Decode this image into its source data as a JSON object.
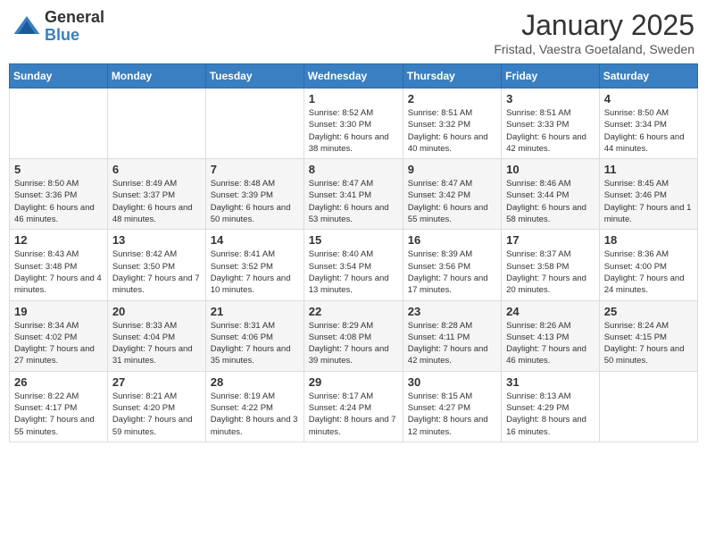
{
  "logo": {
    "general": "General",
    "blue": "Blue"
  },
  "header": {
    "month": "January 2025",
    "location": "Fristad, Vaestra Goetaland, Sweden"
  },
  "weekdays": [
    "Sunday",
    "Monday",
    "Tuesday",
    "Wednesday",
    "Thursday",
    "Friday",
    "Saturday"
  ],
  "weeks": [
    [
      {
        "day": "",
        "info": ""
      },
      {
        "day": "",
        "info": ""
      },
      {
        "day": "",
        "info": ""
      },
      {
        "day": "1",
        "info": "Sunrise: 8:52 AM\nSunset: 3:30 PM\nDaylight: 6 hours and 38 minutes."
      },
      {
        "day": "2",
        "info": "Sunrise: 8:51 AM\nSunset: 3:32 PM\nDaylight: 6 hours and 40 minutes."
      },
      {
        "day": "3",
        "info": "Sunrise: 8:51 AM\nSunset: 3:33 PM\nDaylight: 6 hours and 42 minutes."
      },
      {
        "day": "4",
        "info": "Sunrise: 8:50 AM\nSunset: 3:34 PM\nDaylight: 6 hours and 44 minutes."
      }
    ],
    [
      {
        "day": "5",
        "info": "Sunrise: 8:50 AM\nSunset: 3:36 PM\nDaylight: 6 hours and 46 minutes."
      },
      {
        "day": "6",
        "info": "Sunrise: 8:49 AM\nSunset: 3:37 PM\nDaylight: 6 hours and 48 minutes."
      },
      {
        "day": "7",
        "info": "Sunrise: 8:48 AM\nSunset: 3:39 PM\nDaylight: 6 hours and 50 minutes."
      },
      {
        "day": "8",
        "info": "Sunrise: 8:47 AM\nSunset: 3:41 PM\nDaylight: 6 hours and 53 minutes."
      },
      {
        "day": "9",
        "info": "Sunrise: 8:47 AM\nSunset: 3:42 PM\nDaylight: 6 hours and 55 minutes."
      },
      {
        "day": "10",
        "info": "Sunrise: 8:46 AM\nSunset: 3:44 PM\nDaylight: 6 hours and 58 minutes."
      },
      {
        "day": "11",
        "info": "Sunrise: 8:45 AM\nSunset: 3:46 PM\nDaylight: 7 hours and 1 minute."
      }
    ],
    [
      {
        "day": "12",
        "info": "Sunrise: 8:43 AM\nSunset: 3:48 PM\nDaylight: 7 hours and 4 minutes."
      },
      {
        "day": "13",
        "info": "Sunrise: 8:42 AM\nSunset: 3:50 PM\nDaylight: 7 hours and 7 minutes."
      },
      {
        "day": "14",
        "info": "Sunrise: 8:41 AM\nSunset: 3:52 PM\nDaylight: 7 hours and 10 minutes."
      },
      {
        "day": "15",
        "info": "Sunrise: 8:40 AM\nSunset: 3:54 PM\nDaylight: 7 hours and 13 minutes."
      },
      {
        "day": "16",
        "info": "Sunrise: 8:39 AM\nSunset: 3:56 PM\nDaylight: 7 hours and 17 minutes."
      },
      {
        "day": "17",
        "info": "Sunrise: 8:37 AM\nSunset: 3:58 PM\nDaylight: 7 hours and 20 minutes."
      },
      {
        "day": "18",
        "info": "Sunrise: 8:36 AM\nSunset: 4:00 PM\nDaylight: 7 hours and 24 minutes."
      }
    ],
    [
      {
        "day": "19",
        "info": "Sunrise: 8:34 AM\nSunset: 4:02 PM\nDaylight: 7 hours and 27 minutes."
      },
      {
        "day": "20",
        "info": "Sunrise: 8:33 AM\nSunset: 4:04 PM\nDaylight: 7 hours and 31 minutes."
      },
      {
        "day": "21",
        "info": "Sunrise: 8:31 AM\nSunset: 4:06 PM\nDaylight: 7 hours and 35 minutes."
      },
      {
        "day": "22",
        "info": "Sunrise: 8:29 AM\nSunset: 4:08 PM\nDaylight: 7 hours and 39 minutes."
      },
      {
        "day": "23",
        "info": "Sunrise: 8:28 AM\nSunset: 4:11 PM\nDaylight: 7 hours and 42 minutes."
      },
      {
        "day": "24",
        "info": "Sunrise: 8:26 AM\nSunset: 4:13 PM\nDaylight: 7 hours and 46 minutes."
      },
      {
        "day": "25",
        "info": "Sunrise: 8:24 AM\nSunset: 4:15 PM\nDaylight: 7 hours and 50 minutes."
      }
    ],
    [
      {
        "day": "26",
        "info": "Sunrise: 8:22 AM\nSunset: 4:17 PM\nDaylight: 7 hours and 55 minutes."
      },
      {
        "day": "27",
        "info": "Sunrise: 8:21 AM\nSunset: 4:20 PM\nDaylight: 7 hours and 59 minutes."
      },
      {
        "day": "28",
        "info": "Sunrise: 8:19 AM\nSunset: 4:22 PM\nDaylight: 8 hours and 3 minutes."
      },
      {
        "day": "29",
        "info": "Sunrise: 8:17 AM\nSunset: 4:24 PM\nDaylight: 8 hours and 7 minutes."
      },
      {
        "day": "30",
        "info": "Sunrise: 8:15 AM\nSunset: 4:27 PM\nDaylight: 8 hours and 12 minutes."
      },
      {
        "day": "31",
        "info": "Sunrise: 8:13 AM\nSunset: 4:29 PM\nDaylight: 8 hours and 16 minutes."
      },
      {
        "day": "",
        "info": ""
      }
    ]
  ]
}
